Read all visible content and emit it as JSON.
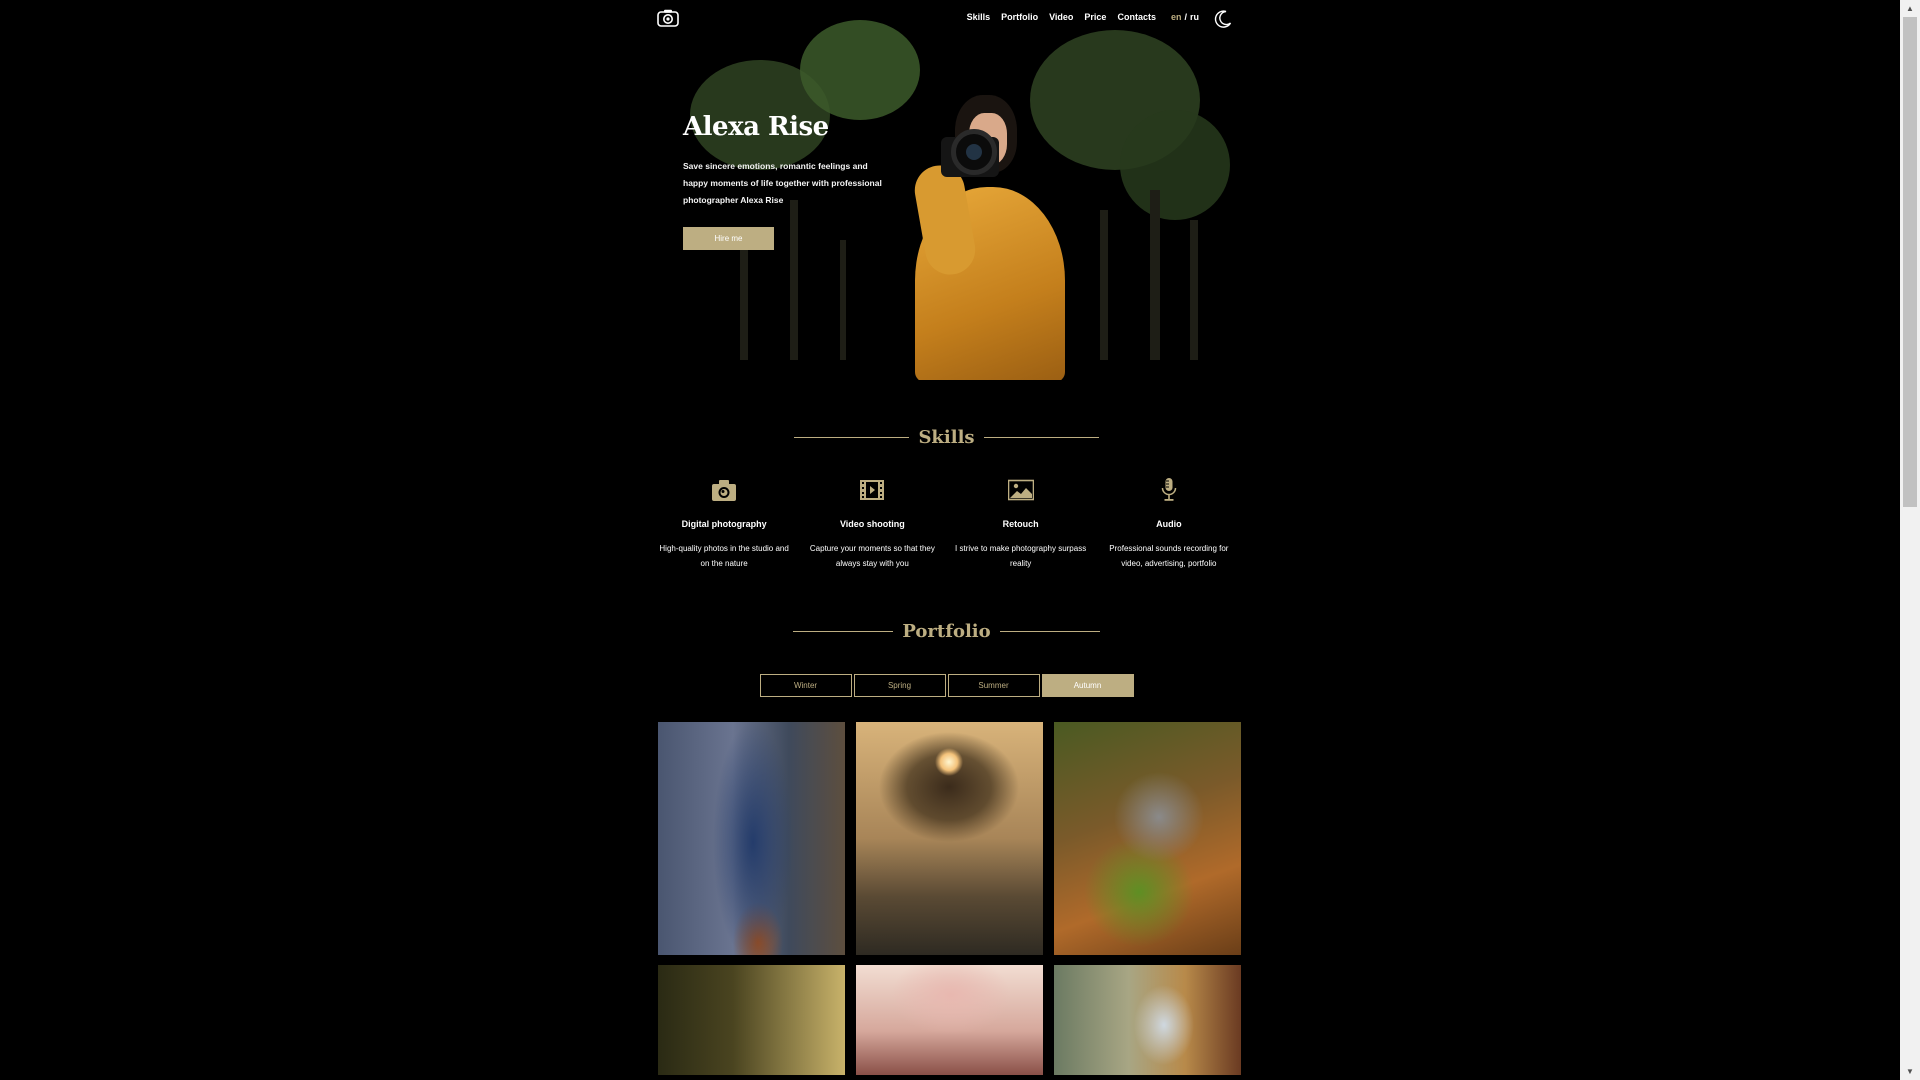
{
  "nav": {
    "logo_icon": "camera-logo-icon",
    "links": [
      "Skills",
      "Portfolio",
      "Video",
      "Price",
      "Contacts"
    ],
    "lang_en": "en",
    "lang_sep": "/",
    "lang_ru": "ru",
    "theme_icon": "moon-icon"
  },
  "hero": {
    "title": "Alexa Rise",
    "description": "Save sincere emotions, romantic feelings and happy moments of life together with professional photographer Alexa Rise",
    "button": "Hire me"
  },
  "skills": {
    "title": "Skills",
    "items": [
      {
        "icon": "camera-icon",
        "name": "Digital photography",
        "desc": "High-quality photos in the studio and on the nature"
      },
      {
        "icon": "film-icon",
        "name": "Video shooting",
        "desc": "Capture your moments so that they always stay with you"
      },
      {
        "icon": "picture-icon",
        "name": "Retouch",
        "desc": "I strive to make photography surpass reality"
      },
      {
        "icon": "microphone-icon",
        "name": "Audio",
        "desc": "Professional sounds recording for video, advertising, portfolio"
      }
    ]
  },
  "portfolio": {
    "title": "Portfolio",
    "tabs": [
      "Winter",
      "Spring",
      "Summer",
      "Autumn"
    ],
    "active_tab": "Autumn"
  },
  "colors": {
    "accent": "#bdae82",
    "background": "#000000"
  }
}
